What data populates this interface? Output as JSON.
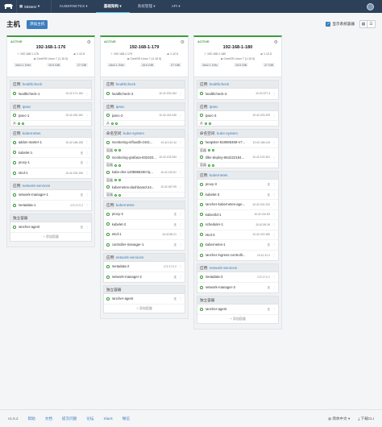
{
  "nav": {
    "environment": "k8stest",
    "items": [
      "KUBERNETES",
      "基础架构",
      "系统管理",
      "API"
    ],
    "active_index": 1
  },
  "page": {
    "title": "主机",
    "add_button": "添加主机",
    "show_system_label": "显示系统容器"
  },
  "hosts": [
    {
      "state": "ACTIVE",
      "name": "192-168-1-176",
      "ip": "192.168.1.176",
      "docker": "1.12.5",
      "os": "CentOS Linux 7 (1.10.0)",
      "cpu": "16x2.1 GHz",
      "ram": "15.5 GiB",
      "disk": "27 GiB",
      "stacks": [
        {
          "label": "应用:",
          "name": "healthcheck",
          "containers": [
            {
              "name": "healthcheck-1",
              "ip": "10.42.171.184"
            }
          ]
        },
        {
          "label": "应用:",
          "name": "ipsec",
          "containers": [
            {
              "name": "ipsec-1",
              "ip": "10.42.200.181"
            }
          ],
          "sidekick": "从"
        },
        {
          "label": "应用:",
          "name": "kubernetes",
          "containers": [
            {
              "name": "addon-starter-1",
              "ip": "10.42.186.155"
            },
            {
              "name": "kubelet-1",
              "ip": "无"
            },
            {
              "name": "proxy-1",
              "ip": "无"
            },
            {
              "name": "etcd-1",
              "ip": "10.42.200.150"
            }
          ]
        },
        {
          "label": "应用:",
          "name": "network-services",
          "containers": [
            {
              "name": "network-manager-1",
              "ip": "无"
            },
            {
              "name": "metadata-1",
              "ip": "172.17.0.2"
            }
          ]
        },
        {
          "label": "独立容器",
          "name": "",
          "containers": [
            {
              "name": "rancher-agent",
              "ip": "无"
            }
          ],
          "add": "+ 添加容器"
        }
      ]
    },
    {
      "state": "ACTIVE",
      "name": "192-168-1-179",
      "ip": "192.168.1.179",
      "docker": "1.12.5",
      "os": "CentOS Linux 7 (1.10.0)",
      "cpu": "16x2.1 GHz",
      "ram": "15.5 GiB",
      "disk": "27 GiB",
      "stacks": [
        {
          "label": "应用:",
          "name": "healthcheck",
          "containers": [
            {
              "name": "healthcheck-2",
              "ip": "10.42.203.164"
            }
          ]
        },
        {
          "label": "应用:",
          "name": "ipsec",
          "containers": [
            {
              "name": "ipsec-2",
              "ip": "10.42.243.245"
            }
          ],
          "sidekick": "从"
        },
        {
          "label": "命名空间:",
          "name": "kube-system",
          "containers": [
            {
              "name": "monitoring-influxdb-2441...",
              "ip": "10.42.112.44"
            },
            {
              "name": "monitoring-grafana-832403...",
              "ip": "10.42.103.254"
            },
            {
              "name": "kube-dns-1208858260-lq...",
              "ip": "10.42.219.87"
            },
            {
              "name": "kubernetes-dashboard-24...",
              "ip": "10.42.187.99"
            }
          ],
          "badges": [
            "容器",
            "容器",
            "容器",
            "容器"
          ]
        },
        {
          "label": "应用:",
          "name": "kubernetes",
          "containers": [
            {
              "name": "proxy-2",
              "ip": "无"
            },
            {
              "name": "kubelet-2",
              "ip": "无"
            },
            {
              "name": "etcd-1",
              "ip": "10.42.85.21"
            },
            {
              "name": "controller-manager-1",
              "ip": "无"
            }
          ]
        },
        {
          "label": "应用:",
          "name": "network-services",
          "containers": [
            {
              "name": "metadata-2",
              "ip": "172.17.0.2"
            },
            {
              "name": "network-manager-2",
              "ip": "无"
            }
          ]
        },
        {
          "label": "独立容器",
          "name": "",
          "containers": [
            {
              "name": "rancher-agent",
              "ip": "无"
            }
          ],
          "add": "+ 添加容器"
        }
      ]
    },
    {
      "state": "ACTIVE",
      "name": "192-168-1-180",
      "ip": "192.168.1.180",
      "docker": "1.12.5",
      "os": "CentOS Linux 7 (1.10.0)",
      "cpu": "16x2.1 GHz",
      "ram": "15.5 GiB",
      "disk": "27 GiB",
      "stacks": [
        {
          "label": "应用:",
          "name": "healthcheck",
          "containers": [
            {
              "name": "healthcheck-3",
              "ip": "10.42.227.3"
            }
          ]
        },
        {
          "label": "应用:",
          "name": "ipsec",
          "containers": [
            {
              "name": "ipsec-3",
              "ip": "10.42.223.209"
            }
          ],
          "sidekick": "从"
        },
        {
          "label": "命名空间:",
          "name": "kube-system",
          "containers": [
            {
              "name": "heapster-818085469-n7...",
              "ip": "10.42.186.115"
            },
            {
              "name": "tiller-deploy-864222184...",
              "ip": "10.42.123.161"
            }
          ],
          "badges": [
            "容器",
            "容器"
          ]
        },
        {
          "label": "应用:",
          "name": "kubernetes",
          "containers": [
            {
              "name": "proxy-3",
              "ip": "无"
            },
            {
              "name": "kubelet-3",
              "ip": "无"
            },
            {
              "name": "rancher-kubernetes-age...",
              "ip": "10.42.231.232"
            },
            {
              "name": "kubectld-1",
              "ip": "10.42.210.83"
            },
            {
              "name": "scheduler-1",
              "ip": "10.42.59.26"
            },
            {
              "name": "etcd-3",
              "ip": "10.42.219.180"
            },
            {
              "name": "kubernetes-1",
              "ip": "无"
            },
            {
              "name": "rancher-ingress-controllr...",
              "ip": "10.42.12.4"
            }
          ]
        },
        {
          "label": "应用:",
          "name": "network-services",
          "containers": [
            {
              "name": "metadata-3",
              "ip": "172.17.0.2"
            },
            {
              "name": "network-manager-3",
              "ip": "无"
            }
          ]
        },
        {
          "label": "独立容器",
          "name": "",
          "containers": [
            {
              "name": "rancher-agent",
              "ip": "无"
            }
          ],
          "add": "+ 添加容器"
        }
      ]
    }
  ],
  "footer": {
    "version": "v1.6.2",
    "links": [
      "帮助",
      "文档",
      "提交问题",
      "论坛",
      "Slack",
      "微信"
    ],
    "language": "简体中文",
    "download": "下载CLI"
  }
}
